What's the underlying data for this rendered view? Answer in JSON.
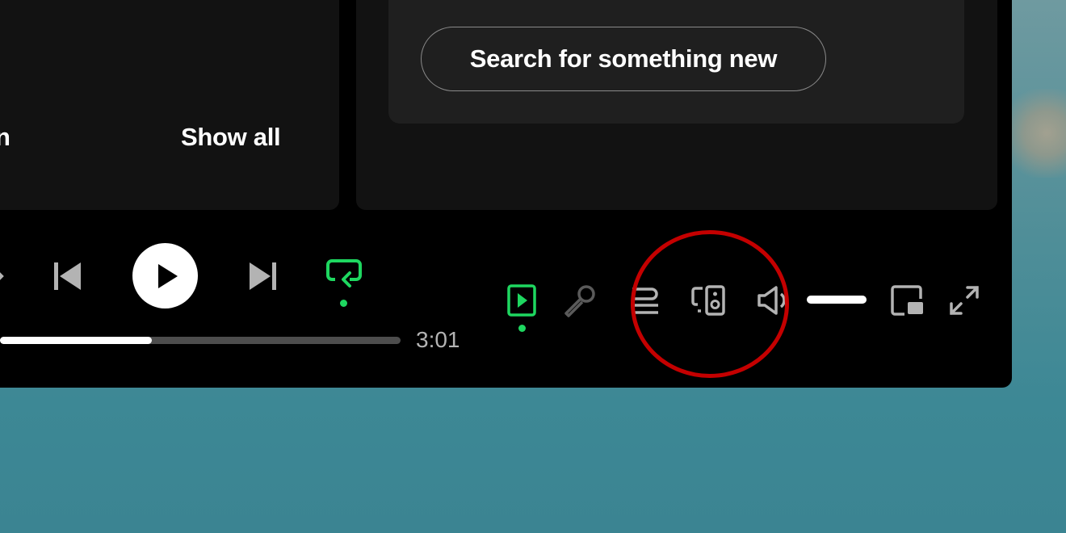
{
  "home": {
    "search_button": "Search for something new",
    "show_all": "Show all",
    "truncated_char": "n"
  },
  "player": {
    "time_total": "3:01",
    "progress_fraction": 0.38,
    "icons": {
      "shuffle": "shuffle-icon",
      "previous": "skip-previous-icon",
      "play": "play-icon",
      "next": "skip-next-icon",
      "repeat": "repeat-one-icon"
    }
  },
  "extra_controls": {
    "volume_fraction": 1.0,
    "icons": [
      "now-playing-view-icon",
      "lyrics-microphone-icon",
      "queue-icon",
      "connect-device-icon",
      "volume-icon",
      "miniplayer-icon",
      "fullscreen-icon"
    ]
  },
  "colors": {
    "accent": "#1ed760",
    "annotation": "#c40000",
    "panel": "#121212",
    "card": "#1f1f1f"
  }
}
